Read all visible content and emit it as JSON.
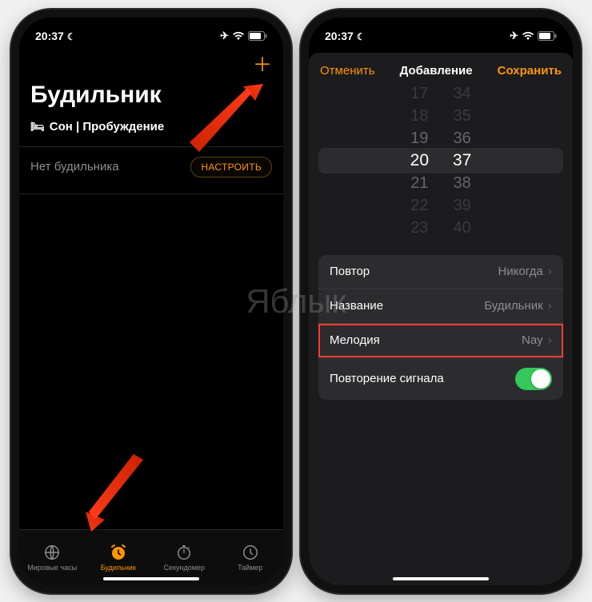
{
  "status": {
    "time": "20:37"
  },
  "left": {
    "title": "Будильник",
    "subtitle": "Сон | Пробуждение",
    "no_alarm": "Нет будильника",
    "setup": "НАСТРОИТЬ",
    "tabs": {
      "world": "Мировые часы",
      "alarm": "Будильник",
      "stopwatch": "Секундомер",
      "timer": "Таймер"
    }
  },
  "right": {
    "cancel": "Отменить",
    "title": "Добавление",
    "save": "Сохранить",
    "picker": {
      "hours": [
        "17",
        "18",
        "19",
        "20",
        "21",
        "22",
        "23"
      ],
      "minutes": [
        "34",
        "35",
        "36",
        "37",
        "38",
        "39",
        "40"
      ]
    },
    "options": {
      "repeat_label": "Повтор",
      "repeat_value": "Никогда",
      "name_label": "Название",
      "name_value": "Будильник",
      "sound_label": "Мелодия",
      "sound_value": "Nay",
      "snooze_label": "Повторение сигнала"
    }
  },
  "watermark": "Яблык"
}
